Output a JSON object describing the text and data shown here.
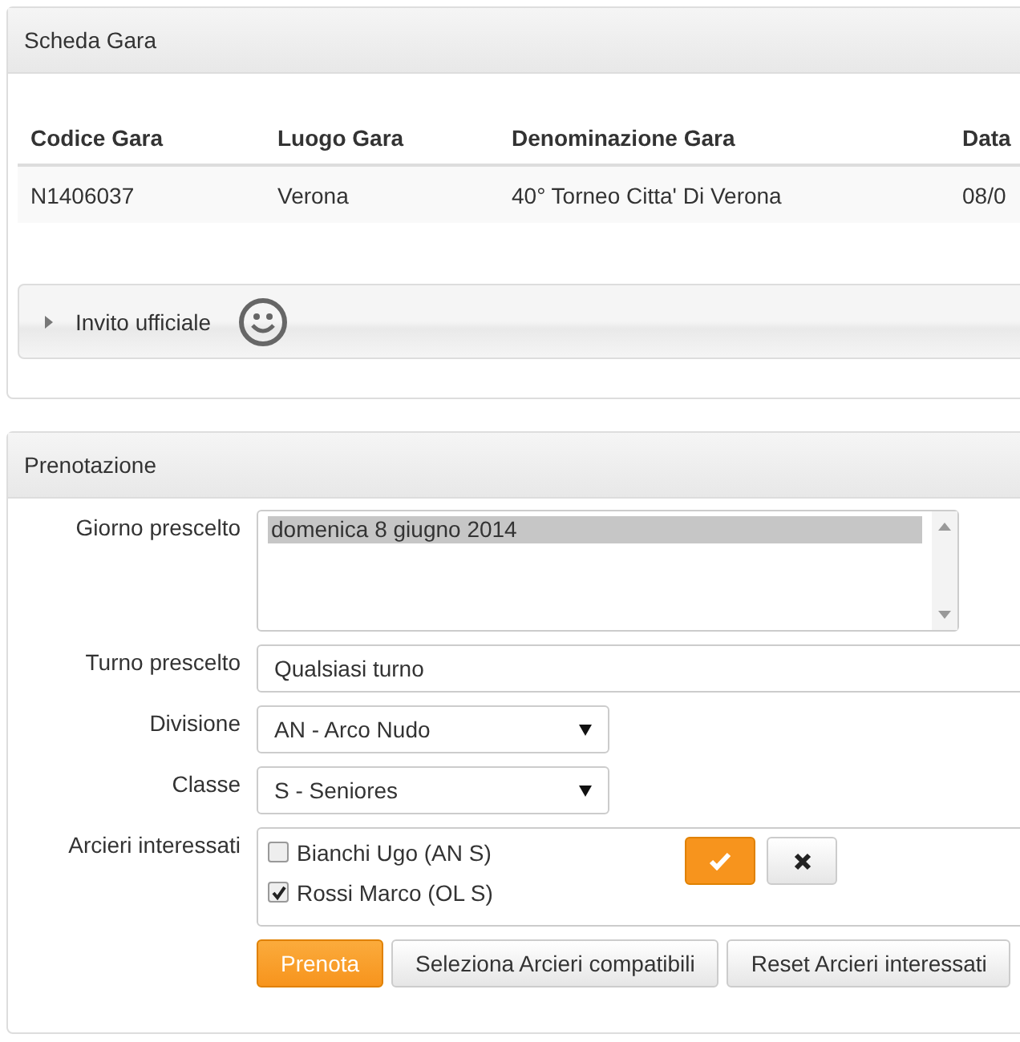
{
  "scheda": {
    "title": "Scheda Gara",
    "table": {
      "columns": [
        "Codice Gara",
        "Luogo Gara",
        "Denominazione Gara",
        "Data"
      ],
      "rows": [
        [
          "N1406037",
          "Verona",
          "40° Torneo Citta' Di Verona",
          "08/0"
        ]
      ]
    },
    "accordion": {
      "label": "Invito ufficiale",
      "expanded": false
    }
  },
  "prenotazione": {
    "title": "Prenotazione",
    "giorno": {
      "label": "Giorno prescelto",
      "options": [
        {
          "text": "domenica 8 giugno 2014",
          "selected": true
        }
      ]
    },
    "turno": {
      "label": "Turno prescelto",
      "value": "Qualsiasi turno"
    },
    "divisione": {
      "label": "Divisione",
      "value": "AN - Arco Nudo"
    },
    "classe": {
      "label": "Classe",
      "value": "S - Seniores"
    },
    "arcieri": {
      "label": "Arcieri interessati",
      "items": [
        {
          "name": "Bianchi Ugo (AN S)",
          "checked": false
        },
        {
          "name": "Rossi Marco (OL S)",
          "checked": true
        }
      ]
    },
    "buttons": [
      {
        "label": "Prenota",
        "kind": "primary"
      },
      {
        "label": "Seleziona Arcieri compatibili",
        "kind": "default"
      },
      {
        "label": "Reset Arcieri interessati",
        "kind": "default"
      }
    ]
  }
}
